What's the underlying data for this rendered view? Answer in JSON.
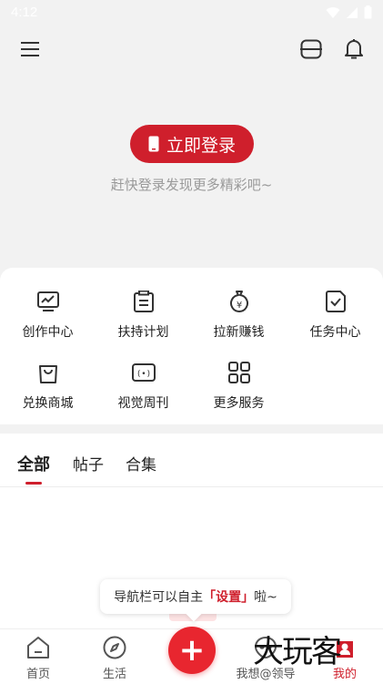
{
  "status_bar": {
    "time": "4:12"
  },
  "login": {
    "button_label": "立即登录",
    "hint": "赶快登录发现更多精彩吧~"
  },
  "services": [
    {
      "label": "创作中心",
      "icon": "chart-monitor-icon"
    },
    {
      "label": "扶持计划",
      "icon": "clipboard-icon"
    },
    {
      "label": "拉新赚钱",
      "icon": "money-bag-icon"
    },
    {
      "label": "任务中心",
      "icon": "task-check-icon"
    },
    {
      "label": "兑换商城",
      "icon": "shopping-bag-icon"
    },
    {
      "label": "视觉周刊",
      "icon": "video-frame-icon"
    },
    {
      "label": "更多服务",
      "icon": "grid-icon"
    }
  ],
  "tabs": [
    {
      "label": "全部",
      "active": true
    },
    {
      "label": "帖子",
      "active": false
    },
    {
      "label": "合集",
      "active": false
    }
  ],
  "tooltip": {
    "before": "导航栏可以自主",
    "highlight": "「设置」",
    "after": "啦~"
  },
  "bottom_nav": [
    {
      "label": "首页",
      "icon": "home-icon"
    },
    {
      "label": "生活",
      "icon": "compass-icon"
    },
    {
      "label": "我想@领导",
      "icon": "alien-icon"
    },
    {
      "label": "我的",
      "icon": "profile-icon",
      "active": true
    }
  ],
  "fab": {
    "label": "+"
  },
  "watermark": "大玩客",
  "colors": {
    "accent": "#cf1f2c",
    "background": "#f2f2f2"
  }
}
